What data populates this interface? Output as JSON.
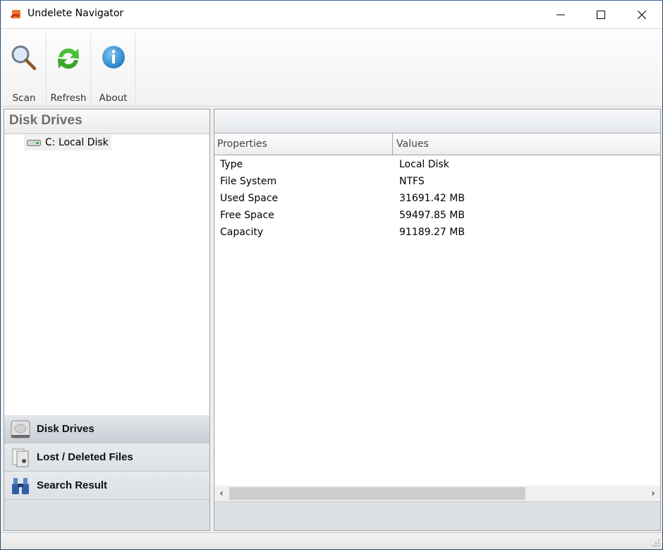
{
  "window": {
    "title": "Undelete Navigator",
    "controls": {
      "minimize": "minimize",
      "maximize": "maximize",
      "close": "close"
    }
  },
  "toolbar": {
    "buttons": [
      {
        "label": "Scan",
        "icon": "magnifier-icon"
      },
      {
        "label": "Refresh",
        "icon": "refresh-icon"
      },
      {
        "label": "About",
        "icon": "info-icon"
      }
    ]
  },
  "left_panel": {
    "header": "Disk Drives",
    "tree": [
      {
        "drive": "C:",
        "label": "C:  Local Disk",
        "icon": "drive-icon"
      }
    ],
    "nav": [
      {
        "label": "Disk Drives",
        "icon": "hard-disk-icon",
        "active": true
      },
      {
        "label": "Lost / Deleted Files",
        "icon": "files-icon",
        "active": false
      },
      {
        "label": "Search Result",
        "icon": "binoculars-icon",
        "active": false
      }
    ]
  },
  "properties": {
    "columns": [
      "Properties",
      "Values"
    ],
    "rows": [
      {
        "property": "Type",
        "value": "Local Disk"
      },
      {
        "property": "File System",
        "value": "NTFS"
      },
      {
        "property": "Used Space",
        "value": "31691.42 MB"
      },
      {
        "property": "Free Space",
        "value": "59497.85 MB"
      },
      {
        "property": "Capacity",
        "value": "91189.27 MB"
      }
    ]
  },
  "scrollbar": {
    "left_arrow": "‹",
    "right_arrow": "›",
    "position_fraction": 0
  },
  "colors": {
    "window_border": "#1f4e79",
    "nav_background": "#dde1e6",
    "header_text": "#6e6e6e"
  }
}
